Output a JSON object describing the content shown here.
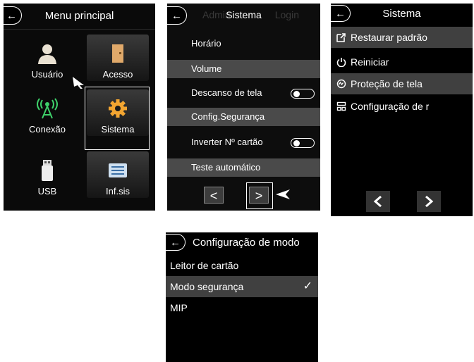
{
  "menu_principal": {
    "title": "Menu principal",
    "back_icon": "back-arrow-icon",
    "tiles": [
      {
        "label": "Usuário",
        "icon": "user-icon"
      },
      {
        "label": "Acesso",
        "icon": "door-icon"
      },
      {
        "label": "Conexão",
        "icon": "signal-tower-icon"
      },
      {
        "label": "Sistema",
        "icon": "gear-icon"
      },
      {
        "label": "USB",
        "icon": "usb-drive-icon"
      },
      {
        "label": "Inf.sis",
        "icon": "info-list-icon"
      }
    ],
    "selected": "Sistema"
  },
  "sistema_list": {
    "title": "Sistema",
    "ghost_left": "Admin",
    "ghost_right": "Login",
    "rows": [
      {
        "label": "Horário"
      },
      {
        "label": "Volume"
      },
      {
        "label": "Descanso de tela",
        "toggle": "off"
      },
      {
        "label": "Config.Segurança"
      },
      {
        "label": "Inverter Nº cartão",
        "toggle": "off"
      },
      {
        "label": "Teste automático"
      }
    ],
    "prev_label": "<",
    "next_label": ">"
  },
  "sistema_settings": {
    "title": "Sistema",
    "rows": [
      {
        "label": "Restaurar padrão",
        "icon": "restore-icon"
      },
      {
        "label": "Reiniciar",
        "icon": "power-icon"
      },
      {
        "label": "Proteção de tela",
        "icon": "screen-protection-icon"
      },
      {
        "label": "Configuração de r",
        "icon": "config-icon"
      }
    ]
  },
  "config_modo": {
    "title": "Configuração de modo",
    "rows": [
      {
        "label": "Leitor de cartão"
      },
      {
        "label": "Modo segurança",
        "selected": true
      },
      {
        "label": "MIP"
      }
    ],
    "check_glyph": "✓"
  }
}
